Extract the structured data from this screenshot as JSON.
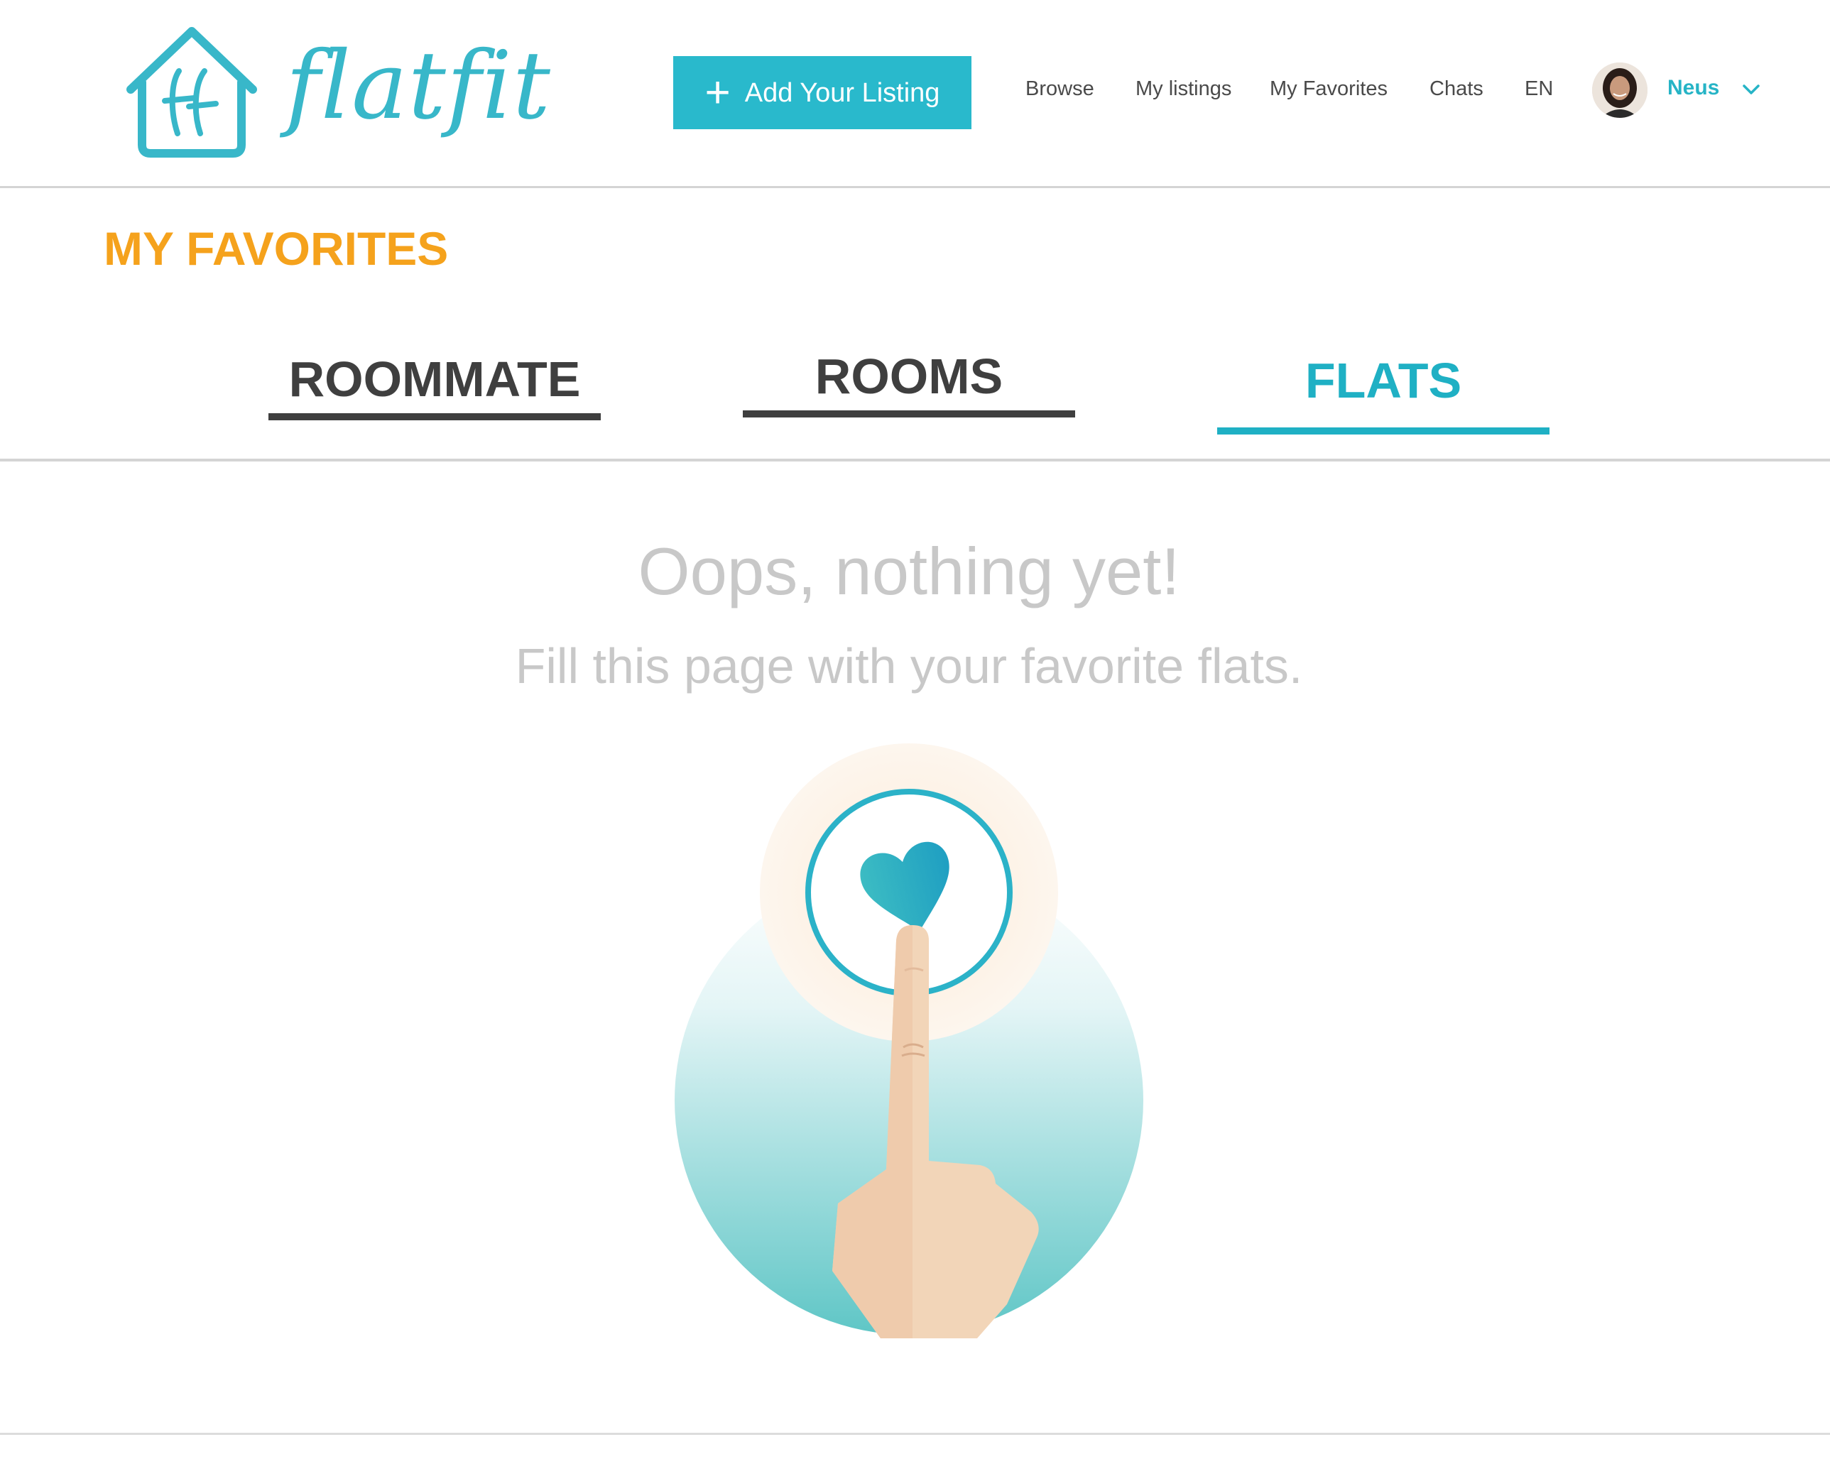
{
  "header": {
    "logo_text": "flatfit",
    "add_listing_label": "Add Your Listing",
    "nav": {
      "browse": "Browse",
      "my_listings": "My listings",
      "my_favorites": "My Favorites",
      "chats": "Chats",
      "language": "EN"
    },
    "user_name": "Neus"
  },
  "page_title": "MY FAVORITES",
  "tabs": [
    {
      "label": "ROOMMATE",
      "active": false
    },
    {
      "label": "ROOMS",
      "active": false
    },
    {
      "label": "FLATS",
      "active": true
    }
  ],
  "empty_state": {
    "title": "Oops, nothing yet!",
    "subtitle": "Fill this page with your favorite flats."
  },
  "colors": {
    "brand_teal": "#29b9cc",
    "accent_orange": "#f5a21c",
    "tab_dark": "#3f3f3f",
    "muted_text": "#c8c8c8"
  },
  "icons": [
    "house-logo-icon",
    "plus-icon",
    "chevron-down-icon",
    "heart-icon"
  ]
}
